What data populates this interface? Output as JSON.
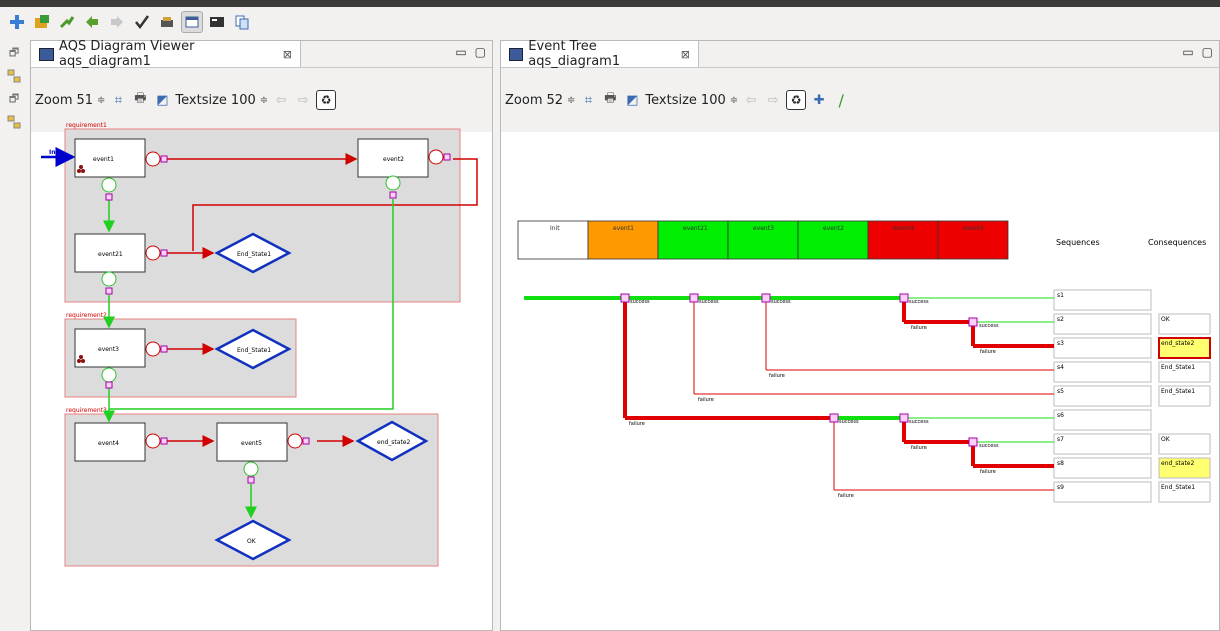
{
  "toolbar": {
    "icons": [
      "new-icon",
      "open-icon",
      "build-icon",
      "back-icon",
      "forward-icon",
      "check-icon",
      "gear-icon",
      "window-icon",
      "terminal-icon",
      "copy-icon"
    ]
  },
  "left": {
    "tab_title": "AQS Diagram Viewer aqs_diagram1",
    "close": "⊠",
    "zoom_label": "Zoom",
    "zoom_value": "51",
    "textsize_label": "Textsize",
    "textsize_value": "100",
    "diagram": {
      "init": "Init",
      "groups": [
        "requirement1",
        "requirement2",
        "requirement3"
      ],
      "events": [
        "event1",
        "event2",
        "event21",
        "event3",
        "event4",
        "event5"
      ],
      "states": [
        "End_State1",
        "End_State1",
        "end_state2",
        "OK"
      ]
    }
  },
  "right": {
    "tab_title": "Event Tree aqs_diagram1",
    "close": "⊠",
    "zoom_label": "Zoom",
    "zoom_value": "52",
    "textsize_label": "Textsize",
    "textsize_value": "100",
    "tree": {
      "header": [
        "Init",
        "event1",
        "event21",
        "event3",
        "event2",
        "event4",
        "event5"
      ],
      "header_colors": [
        "#ffffff",
        "#ff9900",
        "#00ee00",
        "#00ee00",
        "#00ee00",
        "#ee0000",
        "#ee0000"
      ],
      "sequences_label": "Sequences",
      "consequences_label": "Consequences",
      "sequences": [
        "s1",
        "s2",
        "s3",
        "s4",
        "s5",
        "s6",
        "s7",
        "s8",
        "s9"
      ],
      "consequences": [
        "",
        "OK",
        "end_state2",
        "End_State1",
        "End_State1",
        "",
        "OK",
        "end_state2",
        "End_State1"
      ],
      "success": "success",
      "failure": "failure"
    }
  }
}
